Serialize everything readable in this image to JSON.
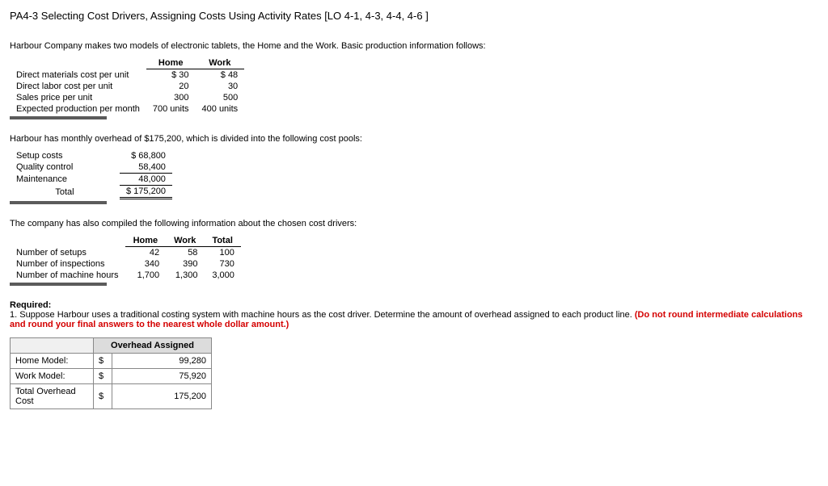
{
  "title": "PA4-3 Selecting Cost Drivers, Assigning Costs Using Activity Rates [LO 4-1, 4-3, 4-4, 4-6 ]",
  "intro": "Harbour Company makes two models of electronic tablets, the Home and the Work. Basic production information follows:",
  "prod": {
    "col1": "Home",
    "col2": "Work",
    "rows": {
      "dm": {
        "label": "Direct materials cost per unit",
        "home": "$  30",
        "work": "$  48"
      },
      "dl": {
        "label": "Direct labor cost per unit",
        "home": "20",
        "work": "30"
      },
      "sp": {
        "label": "Sales price per unit",
        "home": "300",
        "work": "500"
      },
      "ep": {
        "label": "Expected production per month",
        "home": "700 units",
        "work": "400 units"
      }
    }
  },
  "overhead_intro": "Harbour has monthly overhead of $175,200, which is divided into the following cost pools:",
  "pools": {
    "setup": {
      "label": "Setup costs",
      "val": "$   68,800"
    },
    "quality": {
      "label": "Quality control",
      "val": "58,400"
    },
    "maint": {
      "label": "Maintenance",
      "val": "48,000"
    },
    "total": {
      "label": "Total",
      "val": "$ 175,200"
    }
  },
  "drivers_intro": "The company has also compiled the following information about the chosen cost drivers:",
  "drivers": {
    "h1": "Home",
    "h2": "Work",
    "h3": "Total",
    "setups": {
      "label": "Number of setups",
      "home": "42",
      "work": "58",
      "total": "100"
    },
    "insp": {
      "label": "Number of inspections",
      "home": "340",
      "work": "390",
      "total": "730"
    },
    "mh": {
      "label": "Number of machine hours",
      "home": "1,700",
      "work": "1,300",
      "total": "3,000"
    }
  },
  "required_label": "Required:",
  "required_text_a": "1. Suppose Harbour uses a traditional costing system with machine hours as the cost driver. Determine the amount of overhead assigned to each product line. ",
  "required_text_b": "(Do not round intermediate calculations and round your final answers to the nearest whole dollar amount.)",
  "answer": {
    "header": "Overhead Assigned",
    "home": {
      "label": "Home Model:",
      "sym": "$",
      "val": "99,280"
    },
    "work": {
      "label": "Work Model:",
      "sym": "$",
      "val": "75,920"
    },
    "total": {
      "label": "Total Overhead Cost",
      "sym": "$",
      "val": "175,200"
    }
  }
}
